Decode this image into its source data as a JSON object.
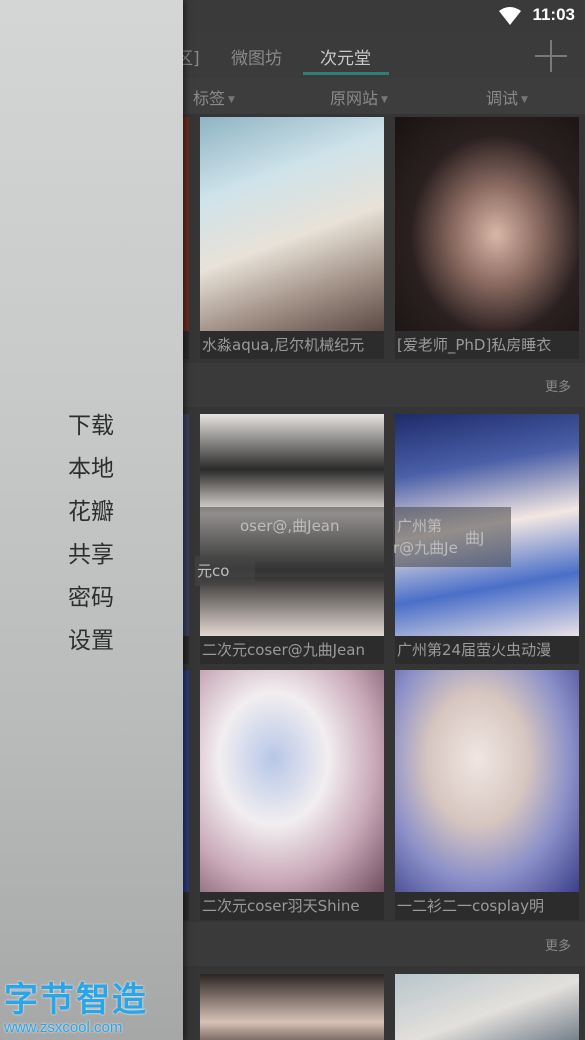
{
  "status": {
    "time": "11:03"
  },
  "tabs": [
    {
      "label": "区]",
      "active": false
    },
    {
      "label": "微图坊",
      "active": false
    },
    {
      "label": "次元堂",
      "active": true
    }
  ],
  "filters": [
    {
      "label": "标签"
    },
    {
      "label": "原网站"
    },
    {
      "label": "调试"
    }
  ],
  "sections": [
    {
      "more_label": "更多"
    },
    {
      "more_label": "更多"
    }
  ],
  "cards": [
    {
      "caption": "水淼aqua,尼尔机械纪元",
      "palette": [
        "#cfe3ea",
        "#e8e2d8",
        "#7a6a60"
      ]
    },
    {
      "caption": "[爱老师_PhD]私房睡衣",
      "palette": [
        "#2a2020",
        "#d9b7a8",
        "#1a1212"
      ]
    },
    {
      "caption": "二次元coser@九曲Jean",
      "palette": [
        "#f0ecea",
        "#1d1d1d",
        "#e3d8d2"
      ]
    },
    {
      "caption": "广州第24届萤火虫动漫",
      "palette": [
        "#4a5fa8",
        "#f3e7e2",
        "#1e2b6a"
      ]
    },
    {
      "caption": "二次元coser羽天Shine",
      "palette": [
        "#b7c7e8",
        "#f2eef0",
        "#6f4f5f"
      ]
    },
    {
      "caption": "一二衫二一cosplay明",
      "palette": [
        "#e6e1e8",
        "#3b3f8a",
        "#d7c6c0"
      ]
    }
  ],
  "ghost_texts": [
    "oser@,曲Jean",
    "广州第",
    "r@九曲Je",
    "曲J",
    "元co"
  ],
  "drawer": {
    "items": [
      "下载",
      "本地",
      "花瓣",
      "共享",
      "密码",
      "设置"
    ]
  },
  "watermark": {
    "name": "字节智造",
    "url": "www.zsxcool.com"
  },
  "colors": {
    "accent": "#2f7e78",
    "watermark": "#2aa6e8"
  }
}
